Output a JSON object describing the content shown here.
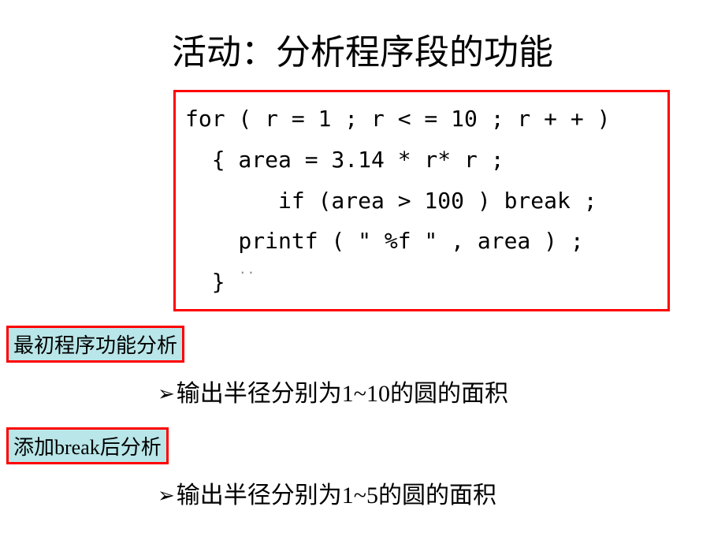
{
  "title": "活动：分析程序段的功能",
  "code": {
    "line1": "for ( r = 1 ; r < = 10 ; r + + )",
    "line2": "  { area = 3.14 * r* r ;",
    "line3": "       if (area > 100 ) break ;",
    "line4": "    printf ( \" %f \" , area ) ;",
    "line5": "  }"
  },
  "watermark": "..",
  "label1": "最初程序功能分析",
  "bullet1": "输出半径分别为1~10的圆的面积",
  "label2": "添加break后分析",
  "bullet2": "输出半径分别为1~5的圆的面积"
}
